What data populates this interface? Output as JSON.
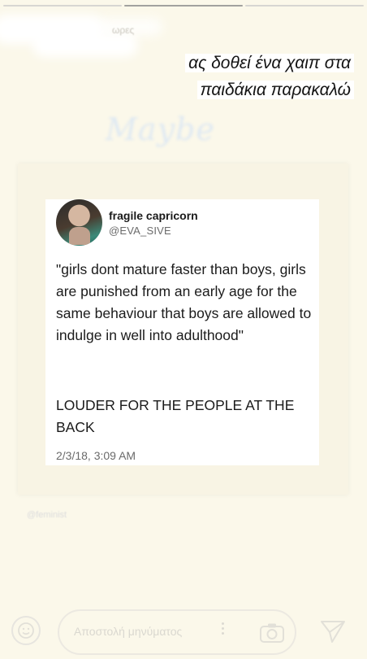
{
  "story": {
    "segments": 3,
    "active_segment": 2,
    "username": "ωρες"
  },
  "caption": {
    "line1": "ας δοθεί ένα χαιπ στα",
    "line2": "παιδάκια παρακαλώ"
  },
  "sticker": {
    "text": "Maybe"
  },
  "tweet": {
    "name": "fragile capricorn",
    "handle": "@EVA_SIVE",
    "body": "\"girls dont mature faster than boys, girls are punished from an early age for the same behaviour that boys are allowed to indulge in well into adulthood\"",
    "extra": "LOUDER FOR THE PEOPLE AT THE BACK",
    "timestamp": "2/3/18, 3:09 AM"
  },
  "watermark": "@feminist",
  "composer": {
    "placeholder": "Αποστολή μηνύματος"
  },
  "icons": {
    "emoji": "smiley-face-icon",
    "more": "more-vertical-icon",
    "camera": "camera-icon",
    "send": "send-paper-plane-icon"
  }
}
